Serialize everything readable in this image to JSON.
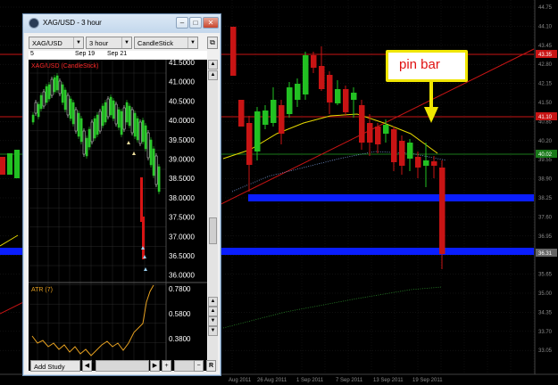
{
  "background_chart": {
    "price_axis": [
      "44.75",
      "44.10",
      "43.45",
      "42.80",
      "42.15",
      "41.50",
      "40.85",
      "40.20",
      "39.55",
      "38.90",
      "38.25",
      "37.60",
      "36.95",
      "36.30",
      "35.65",
      "35.00",
      "34.35",
      "33.70",
      "33.05"
    ],
    "price_flags": [
      {
        "text": "43.35",
        "color": "#c81414"
      },
      {
        "text": "41.10",
        "color": "#c81414"
      },
      {
        "text": "40.02",
        "color": "#1a7a1a"
      },
      {
        "text": "36.31",
        "color": "#666666"
      }
    ],
    "date_axis": [
      "Aug 2011",
      "26 Aug 2011",
      "1 Sep 2011",
      "7 Sep 2011",
      "13 Sep 2011",
      "19 Sep 2011"
    ],
    "colors": {
      "bull": "#22c022",
      "bear": "#c81414",
      "support": "#0a1eff",
      "ma": "#e6d800"
    }
  },
  "callout": {
    "text": "pin bar",
    "border_color": "#f0e600",
    "text_color": "#e01010"
  },
  "window": {
    "title": "XAG/USD - 3 hour",
    "buttons": {
      "minimize": "–",
      "maximize": "□",
      "close": "✕"
    },
    "toolbar": {
      "symbol": "XAG/USD",
      "timeframe": "3 hour",
      "chart_type": "CandleStick"
    },
    "date_bar": {
      "left": "5",
      "d1": "Sep 19",
      "d2": "Sep 21"
    },
    "price_panel": {
      "label": "XAG/USD (CandleStick)",
      "ticks": [
        "41.5000",
        "41.0000",
        "40.5000",
        "40.0000",
        "39.5000",
        "39.0000",
        "38.5000",
        "38.0000",
        "37.5000",
        "37.0000",
        "36.5000",
        "36.0000"
      ]
    },
    "atr_panel": {
      "label": "ATR (7)",
      "ticks": [
        "0.7800",
        "0.5800",
        "0.3800"
      ]
    },
    "bottom": {
      "add_study": "Add Study",
      "plus": "+",
      "minus": "−",
      "reset": "R"
    }
  }
}
